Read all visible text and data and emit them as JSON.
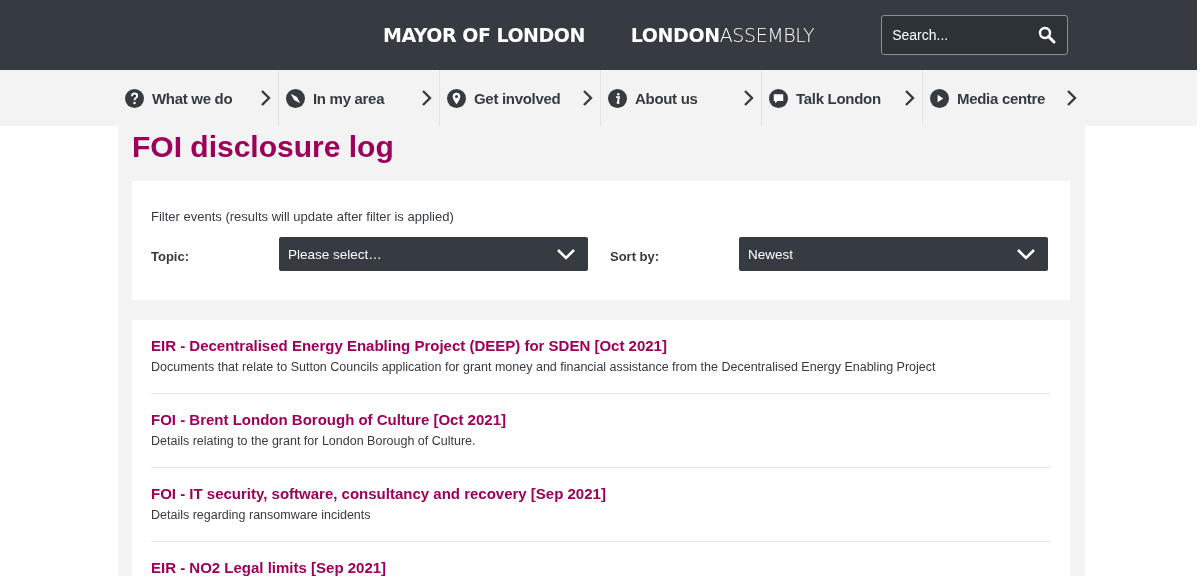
{
  "header": {
    "mayor_logo": "MAYOR OF LONDON",
    "assembly_logo": {
      "bold": "LONDON",
      "light": "ASSEMBLY"
    },
    "search": {
      "placeholder": "Search..."
    }
  },
  "nav": [
    {
      "label": "What we do",
      "kind": "question"
    },
    {
      "label": "In my area",
      "kind": "compass"
    },
    {
      "label": "Get involved",
      "kind": "pin"
    },
    {
      "label": "About us",
      "kind": "info"
    },
    {
      "label": "Talk London",
      "kind": "chat"
    },
    {
      "label": "Media centre",
      "kind": "play"
    }
  ],
  "page_title": "FOI disclosure log",
  "filter": {
    "intro": "Filter events (results will update after filter is applied)",
    "topic_label": "Topic:",
    "topic_value": "Please select…",
    "sort_label": "Sort by:",
    "sort_value": "Newest"
  },
  "results": [
    {
      "title": "EIR - Decentralised Energy Enabling Project (DEEP) for SDEN [Oct 2021]",
      "summary": "Documents that relate to Sutton Councils application for grant money and financial assistance from the Decentralised Energy Enabling Project"
    },
    {
      "title": "FOI - Brent London Borough of Culture [Oct 2021]",
      "summary": "Details relating to the grant for London Borough of Culture."
    },
    {
      "title": "FOI - IT security, software, consultancy and recovery [Sep 2021]",
      "summary": "Details regarding ransomware incidents"
    },
    {
      "title": "EIR - NO2 Legal limits [Sep 2021]"
    }
  ]
}
